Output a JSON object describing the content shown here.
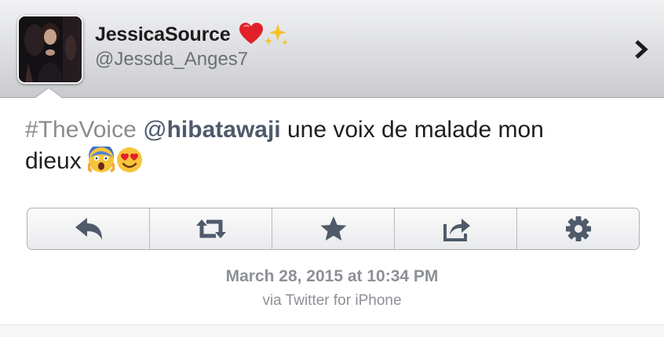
{
  "header": {
    "display_name": "JessicaSource",
    "name_emojis": [
      "red-heart",
      "sparkles"
    ],
    "handle": "@Jessda_Anges7",
    "chevron_icon": "chevron-right-icon"
  },
  "tweet": {
    "hashtag": "#TheVoice",
    "mention_at": "@",
    "mention_name": "hibatawaji",
    "text_line1_rest": " une voix de malade mon",
    "text_line2": "dieux ",
    "emojis": [
      "face-screaming-in-fear",
      "smiling-face-with-heart-eyes"
    ]
  },
  "actions": [
    {
      "name": "reply",
      "icon": "reply-icon"
    },
    {
      "name": "retweet",
      "icon": "retweet-icon"
    },
    {
      "name": "favorite",
      "icon": "star-icon"
    },
    {
      "name": "share",
      "icon": "share-icon"
    },
    {
      "name": "settings",
      "icon": "gear-icon"
    }
  ],
  "meta": {
    "timestamp": "March 28, 2015 at 10:34 PM",
    "via": "via Twitter for iPhone"
  },
  "colors": {
    "header_top": "#f1f2f4",
    "header_bottom": "#c9cacd",
    "text": "#1f1f1f",
    "hashtag": "#8a8c90",
    "mention": "#4e5a6c",
    "meta": "#8d9095",
    "icon": "#4f5a6a"
  }
}
